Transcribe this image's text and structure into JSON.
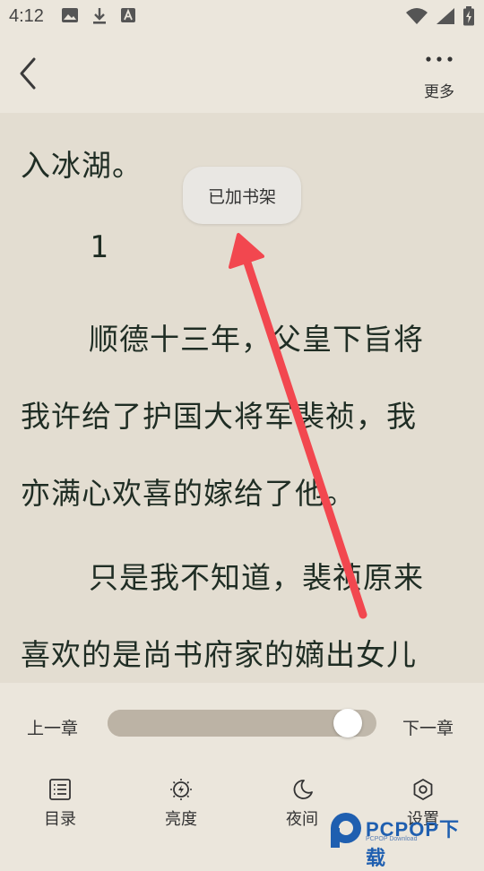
{
  "status_bar": {
    "time": "4:12",
    "left_icons": [
      "image-icon",
      "download-icon",
      "font-icon"
    ],
    "right_icons": [
      "wifi-icon",
      "signal-icon",
      "battery-icon"
    ]
  },
  "header": {
    "back_icon": "chevron-left-icon",
    "more_label": "更多"
  },
  "reader": {
    "lines": [
      "入冰湖。",
      "顺德十三年，父皇下旨将",
      "我许给了护国大将军裴祯，我",
      "亦满心欢喜的嫁给了他。",
      "只是我不知道，裴祯原来",
      "喜欢的是尚书府家的嫡出女儿"
    ],
    "chapter_number": "1",
    "toast": "已加书架",
    "background": "#e3ddd1",
    "annotation_arrow_color": "#f2474f"
  },
  "panel": {
    "prev_chapter": "上一章",
    "next_chapter": "下一章",
    "progress": 0.94,
    "tabs": [
      {
        "label": "目录",
        "icon": "list-icon"
      },
      {
        "label": "亮度",
        "icon": "brightness-icon"
      },
      {
        "label": "夜间",
        "icon": "moon-icon"
      },
      {
        "label": "设置",
        "icon": "settings-icon"
      }
    ]
  },
  "watermark": {
    "brand": "PCPOP下载",
    "sub": "PCPOP Download"
  }
}
